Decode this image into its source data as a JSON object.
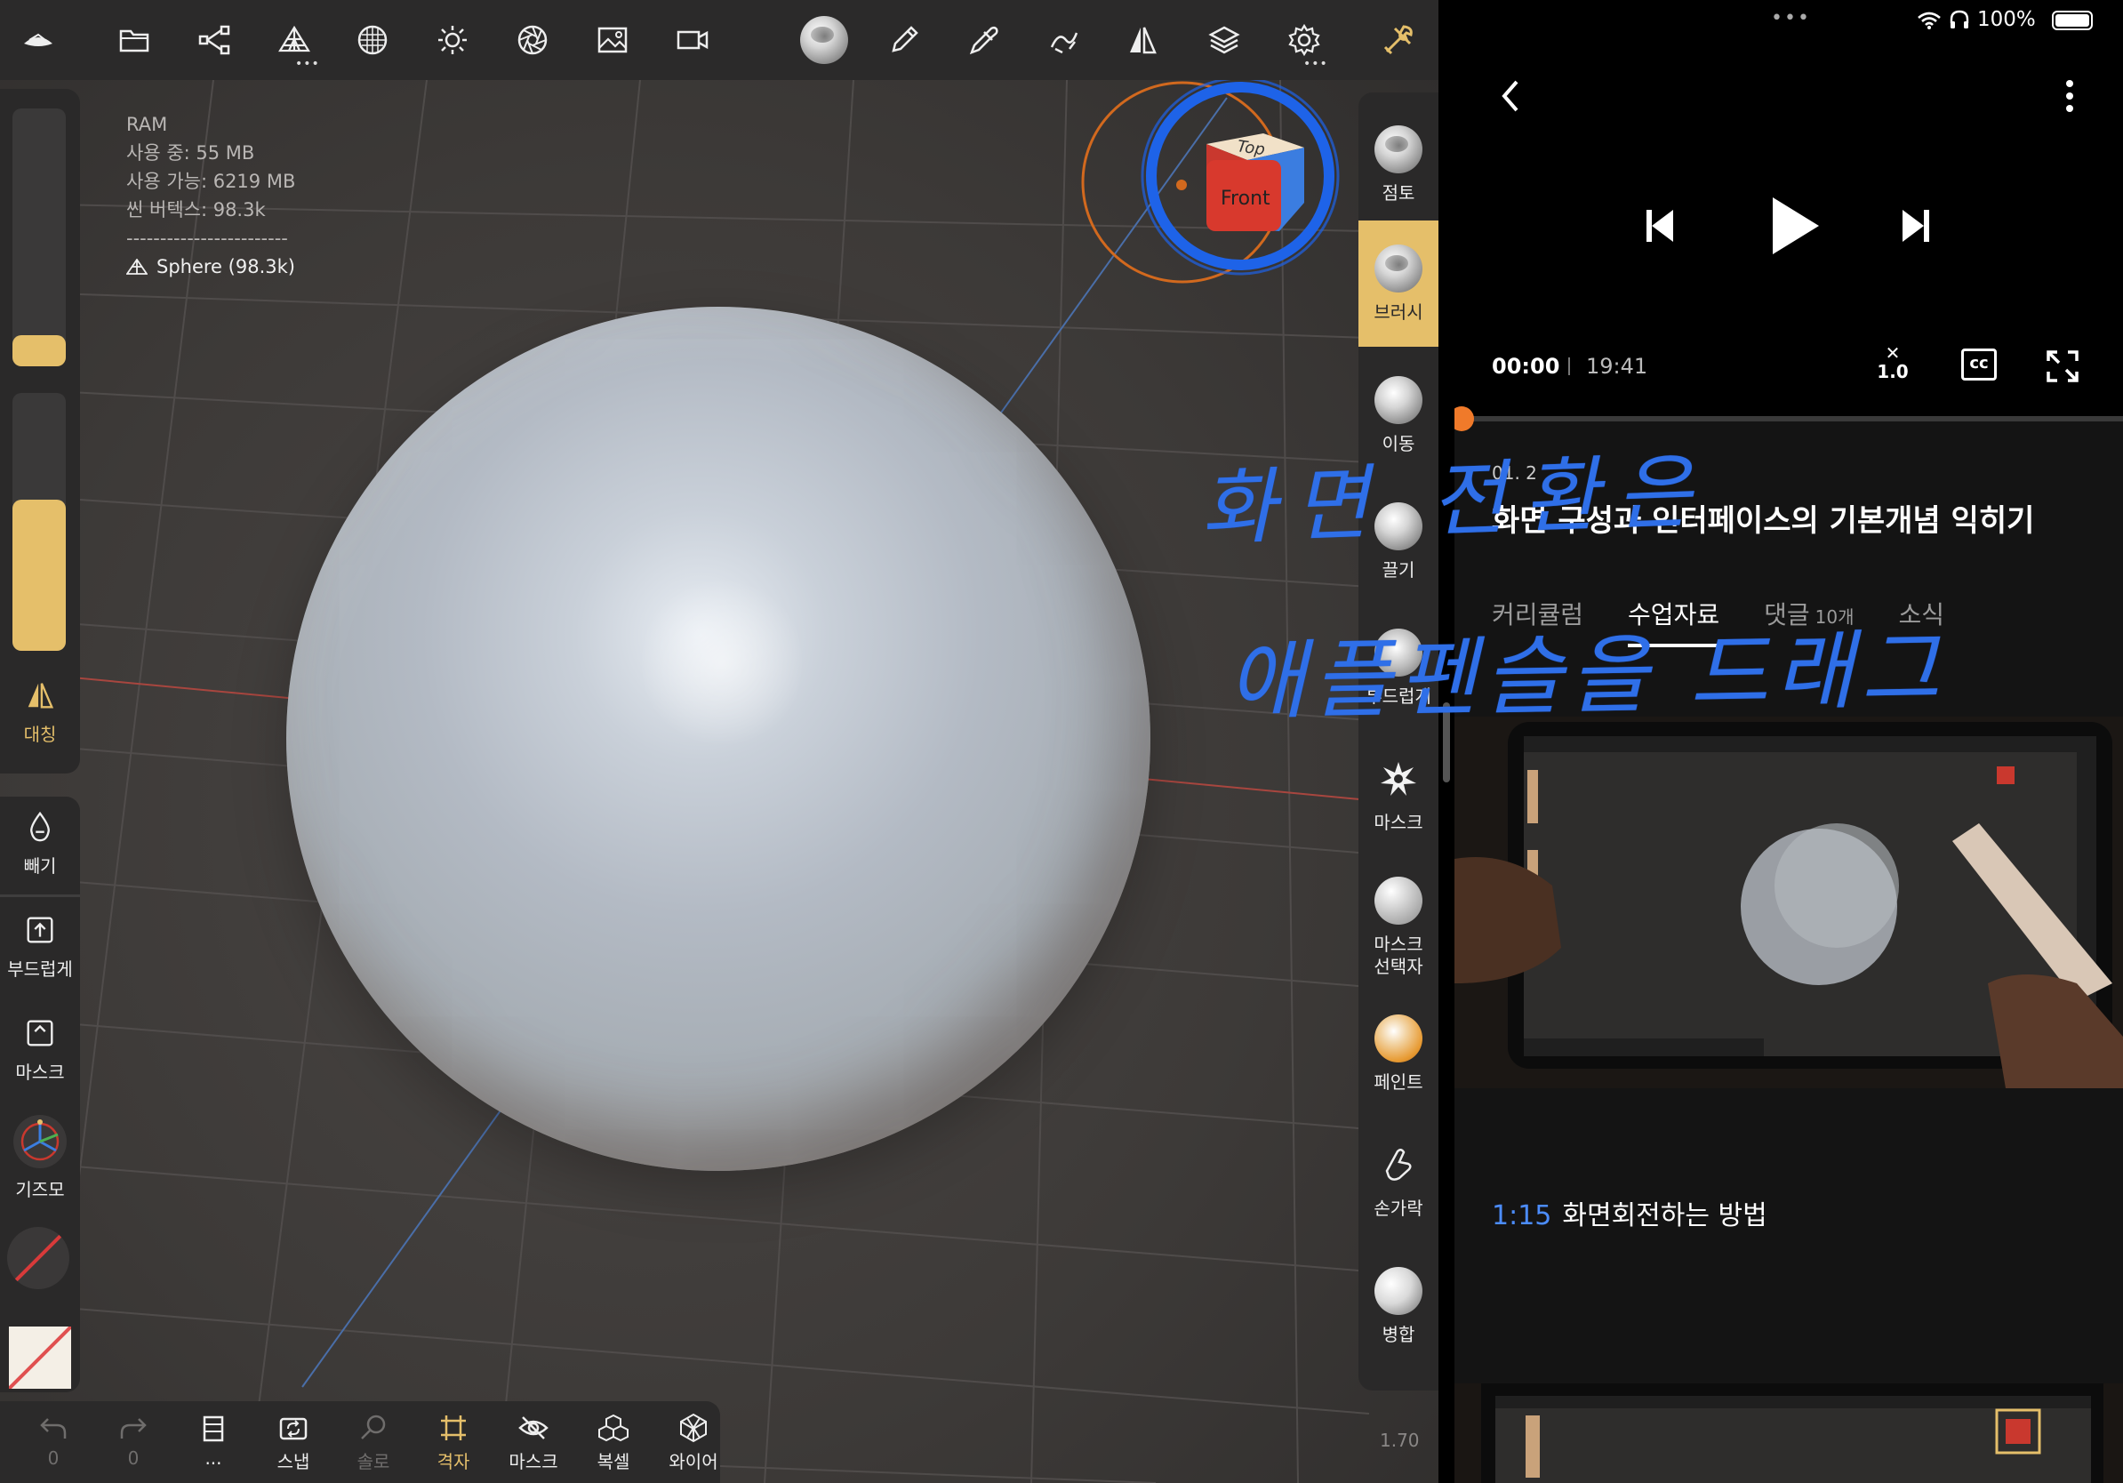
{
  "app": {
    "stats": {
      "ram_label": "RAM",
      "used": "사용 중: 55 MB",
      "available": "사용 가능: 6219 MB",
      "scene_vertices": "씬 버텍스: 98.3k",
      "separator": "------------------------",
      "mesh": "Sphere (98.3k)"
    },
    "gizmo": {
      "top": "Top",
      "front": "Front"
    },
    "left_sidebar": {
      "symmetry": "대칭",
      "subtract": "빼기",
      "smooth": "부드럽게",
      "mask": "마스크",
      "gizmo": "기즈모",
      "slider1_level": 0.1,
      "slider2_level": 0.57
    },
    "tools": [
      {
        "label": "점토",
        "icon": "clay-ball-icon"
      },
      {
        "label": "브러시",
        "icon": "brush-ball-icon"
      },
      {
        "label": "이동",
        "icon": "move-ball-icon"
      },
      {
        "label": "끌기",
        "icon": "drag-ball-icon"
      },
      {
        "label": "부드럽게",
        "icon": "smooth-ball-icon"
      },
      {
        "label": "마스크",
        "icon": "mask-splat-icon"
      },
      {
        "label": "마스크\n선택자",
        "icon": "mask-selector-icon"
      },
      {
        "label": "페인트",
        "icon": "paint-ball-icon"
      },
      {
        "label": "손가락",
        "icon": "finger-icon"
      },
      {
        "label": "병합",
        "icon": "merge-ball-icon"
      }
    ],
    "bottom": {
      "undo_count": "0",
      "redo_count": "0",
      "more": "...",
      "snap": "스냅",
      "solo": "솔로",
      "grid": "격자",
      "mask": "마스크",
      "clone": "복셀",
      "wire": "와이어"
    },
    "version": "1.70"
  },
  "pane": {
    "status": {
      "dots": "•••",
      "battery": "100%"
    },
    "player": {
      "current_time": "00:00",
      "duration": "19:41",
      "speed": "1.0",
      "cc": "cc",
      "progress": 0.0
    },
    "lesson_number": "01. 2",
    "lesson_title": "화면 구성과 인터페이스의 기본개념 익히기",
    "tabs": [
      {
        "label": "커리큘럼",
        "count": ""
      },
      {
        "label": "수업자료",
        "count": ""
      },
      {
        "label": "댓글",
        "count": "10개"
      },
      {
        "label": "소식",
        "count": ""
      }
    ],
    "timestamp": {
      "time": "1:15",
      "text": "화면회전하는 방법"
    }
  },
  "handwriting": {
    "line1": "화면 전환은",
    "line2": "애플펜슬을 드래그"
  },
  "colors": {
    "accent": "#e5bf6a",
    "link": "#4c8dff",
    "progress": "#f07a2a",
    "handwriting": "#2f6fe8"
  }
}
